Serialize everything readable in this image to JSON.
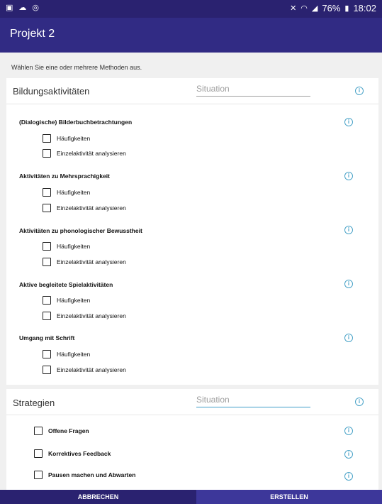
{
  "status_bar": {
    "battery": "76%",
    "time": "18:02"
  },
  "app_bar": {
    "title": "Projekt 2"
  },
  "hint": "Wählen Sie eine oder mehrere Methoden aus.",
  "section1": {
    "title": "Bildungsaktivitäten",
    "situation_placeholder": "Situation",
    "methods": [
      {
        "title": "(Dialogische) Bilderbuchbetrachtungen",
        "options": [
          "Häufigkeiten",
          "Einzelaktivität analysieren"
        ]
      },
      {
        "title": "Aktivitäten zu Mehrsprachigkeit",
        "options": [
          "Häufigkeiten",
          "Einzelaktivität analysieren"
        ]
      },
      {
        "title": "Aktivitäten zu phonologischer Bewusstheit",
        "options": [
          "Häufigkeiten",
          "Einzelaktivität analysieren"
        ]
      },
      {
        "title": "Aktive begleitete Spielaktivitäten",
        "options": [
          "Häufigkeiten",
          "Einzelaktivität analysieren"
        ]
      },
      {
        "title": "Umgang mit Schrift",
        "options": [
          "Häufigkeiten",
          "Einzelaktivität analysieren"
        ]
      }
    ]
  },
  "section2": {
    "title": "Strategien",
    "situation_placeholder": "Situation",
    "items": [
      "Offene Fragen",
      "Korrektives Feedback",
      "Pausen machen und Abwarten"
    ]
  },
  "buttons": {
    "cancel": "ABBRECHEN",
    "create": "ERSTELLEN"
  }
}
